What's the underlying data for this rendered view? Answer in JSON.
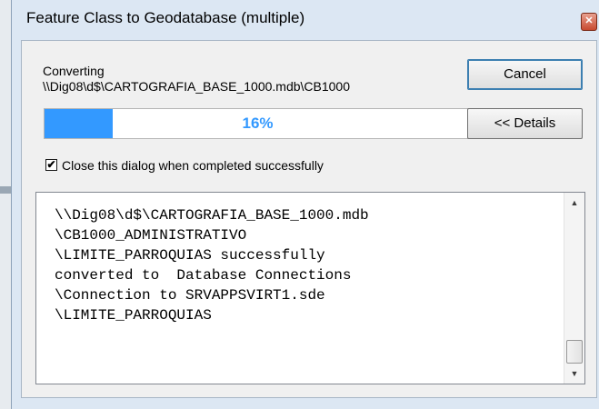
{
  "window": {
    "title": "Feature Class to Geodatabase (multiple)",
    "close_glyph": "✕"
  },
  "status": {
    "label": "Converting",
    "path": "\\\\Dig08\\d$\\CARTOGRAFIA_BASE_1000.mdb\\CB1000",
    "progress_fraction": 0.16,
    "progress_text": "16%"
  },
  "buttons": {
    "cancel": "Cancel",
    "details": "<< Details"
  },
  "close_option": {
    "label": "Close this dialog when completed successfully",
    "checked": true,
    "check_glyph": "✔"
  },
  "log": {
    "lines": [
      "\\\\Dig08\\d$\\CARTOGRAFIA_BASE_1000.mdb",
      "\\CB1000_ADMINISTRATIVO",
      "\\LIMITE_PARROQUIAS successfully",
      "converted to  Database Connections",
      "\\Connection to SRVAPPSVIRT1.sde",
      "\\LIMITE_PARROQUIAS"
    ],
    "scroll_up_glyph": "▲",
    "scroll_down_glyph": "▼"
  },
  "colors": {
    "progress_fill": "#3399ff",
    "title_bar": "#dce7f3"
  }
}
